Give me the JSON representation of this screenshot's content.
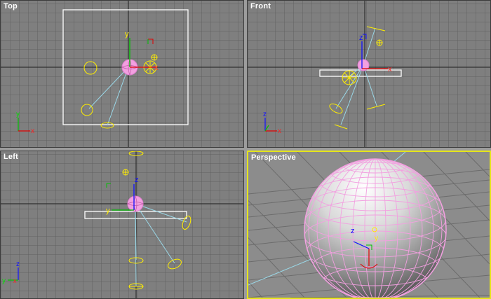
{
  "viewports": {
    "top": {
      "label": "Top"
    },
    "front": {
      "label": "Front"
    },
    "left": {
      "label": "Left"
    },
    "perspective": {
      "label": "Perspective"
    }
  },
  "axes": {
    "x": "x",
    "y": "y",
    "z": "z"
  },
  "colors": {
    "viewport_bg": "#7f7f7f",
    "grid": "#5f5f5f",
    "grid_major": "#1e1e1e",
    "active_border": "#e5e51a",
    "sphere": "#f2a0e0",
    "light": "#ffee00",
    "target_line": "#9ad8e8",
    "selection_box": "#ffffff",
    "axis_x": "#e00000",
    "axis_y": "#00c000",
    "axis_z": "#1010ff"
  }
}
